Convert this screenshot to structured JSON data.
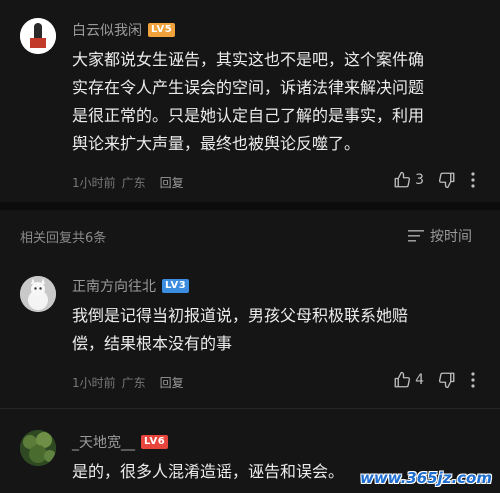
{
  "main_comment": {
    "username": "白云似我闲",
    "level": "LV5",
    "text_lines": [
      "大家都说女生诬告，其实这也不是吧，这个案件确",
      "实存在令人产生误会的空间，诉诸法律来解决问题",
      "是很正常的。只是她认定自己了解的是事实，利用",
      "舆论来扩大声量，最终也被舆论反噬了。"
    ],
    "time": "1小时前",
    "location": "广东",
    "reply_label": "回复",
    "like_count": "3"
  },
  "related": {
    "title": "相关回复共6条",
    "sort_label": "按时间"
  },
  "replies": [
    {
      "username": "正南方向往北",
      "level": "LV3",
      "text_lines": [
        "我倒是记得当初报道说，男孩父母积极联系她赔",
        "偿，结果根本没有的事"
      ],
      "time": "1小时前",
      "location": "广东",
      "reply_label": "回复",
      "like_count": "4"
    },
    {
      "username": "_天地宽__",
      "level": "LV6",
      "text_lines": [
        "是的，很多人混淆造谣，诬告和误会。"
      ]
    }
  ],
  "watermark": "www.365jz.com"
}
